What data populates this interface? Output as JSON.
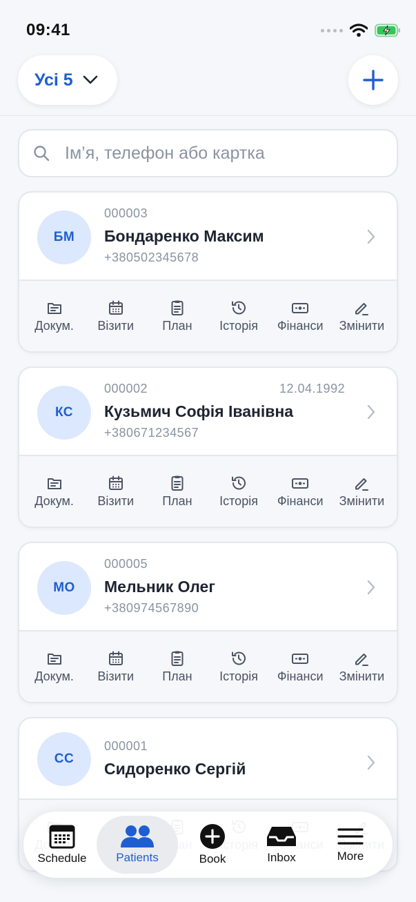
{
  "status": {
    "time": "09:41"
  },
  "header": {
    "filter_label": "Усі 5"
  },
  "search": {
    "placeholder": "Ім’я, телефон або картка"
  },
  "actions": [
    "Докум.",
    "Візити",
    "План",
    "Історія",
    "Фінанси",
    "Змінити"
  ],
  "patients": [
    {
      "initials": "БМ",
      "id": "000003",
      "dob": "",
      "name": "Бондаренко Максим",
      "phone": "+380502345678"
    },
    {
      "initials": "КС",
      "id": "000002",
      "dob": "12.04.1992",
      "name": "Кузьмич Софія Іванівна",
      "phone": "+380671234567"
    },
    {
      "initials": "МО",
      "id": "000005",
      "dob": "",
      "name": "Мельник Олег",
      "phone": "+380974567890"
    },
    {
      "initials": "СС",
      "id": "000001",
      "dob": "",
      "name": "Сидоренко Сергій",
      "phone": ""
    }
  ],
  "tabbar": {
    "schedule": "Schedule",
    "patients": "Patients",
    "book": "Book",
    "inbox": "Inbox",
    "more": "More"
  },
  "colors": {
    "accent": "#1f5ed1",
    "avatar_bg": "#dce8fd",
    "background": "#f5f7fa"
  }
}
